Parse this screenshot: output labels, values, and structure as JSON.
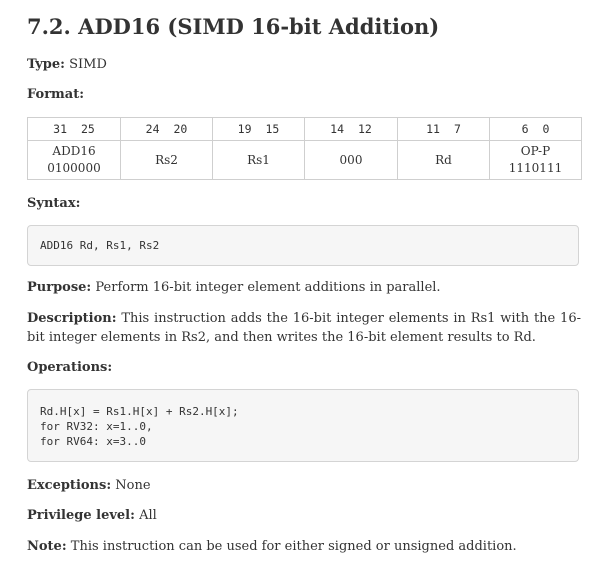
{
  "title": "7.2. ADD16 (SIMD 16-bit Addition)",
  "type": {
    "label": "Type:",
    "value": "SIMD"
  },
  "format": {
    "label": "Format:",
    "bit_ranges": [
      {
        "hi": "31",
        "lo": "25"
      },
      {
        "hi": "24",
        "lo": "20"
      },
      {
        "hi": "19",
        "lo": "15"
      },
      {
        "hi": "14",
        "lo": "12"
      },
      {
        "hi": "11",
        "lo": "7"
      },
      {
        "hi": "6",
        "lo": "0"
      }
    ],
    "fields": [
      {
        "line1": "ADD16",
        "line2": "0100000"
      },
      {
        "line1": "Rs2",
        "line2": ""
      },
      {
        "line1": "Rs1",
        "line2": ""
      },
      {
        "line1": "000",
        "line2": ""
      },
      {
        "line1": "Rd",
        "line2": ""
      },
      {
        "line1": "OP-P",
        "line2": "1110111"
      }
    ]
  },
  "syntax": {
    "label": "Syntax:",
    "code": "ADD16 Rd, Rs1, Rs2"
  },
  "purpose": {
    "label": "Purpose:",
    "text": "Perform 16-bit integer element additions in parallel."
  },
  "description": {
    "label": "Description:",
    "text": "This instruction adds the 16-bit integer elements in Rs1 with the 16-bit integer elements in Rs2, and then writes the 16-bit element results to Rd."
  },
  "operations": {
    "label": "Operations:",
    "lines": [
      "Rd.H[x] = Rs1.H[x] + Rs2.H[x];",
      "for RV32: x=1..0,",
      "for RV64: x=3..0"
    ]
  },
  "exceptions": {
    "label": "Exceptions:",
    "value": "None"
  },
  "privilege": {
    "label": "Privilege level:",
    "value": "All"
  },
  "note": {
    "label": "Note:",
    "text": "This instruction can be used for either signed or unsigned addition."
  }
}
